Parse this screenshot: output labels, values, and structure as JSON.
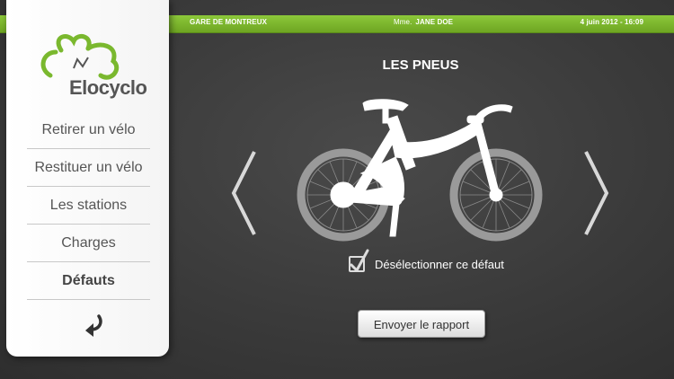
{
  "topbar": {
    "station": "GARE DE MONTREUX",
    "user_prefix": "Mme.",
    "user_name": "JANE DOE",
    "datetime": "4 juin 2012 - 16:09"
  },
  "brand": {
    "name": "Elocyclo",
    "accent": "#7ab82e"
  },
  "menu": {
    "items": [
      {
        "label": "Retirer un vélo"
      },
      {
        "label": "Restituer un vélo"
      },
      {
        "label": "Les stations"
      },
      {
        "label": "Charges"
      },
      {
        "label": "Défauts",
        "active": true
      }
    ],
    "back_icon": "return-arrow-icon"
  },
  "main": {
    "title": "LES PNEUS",
    "checkbox_label": "Désélectionner ce défaut",
    "checkbox_checked": true,
    "send_button": "Envoyer le rapport"
  }
}
